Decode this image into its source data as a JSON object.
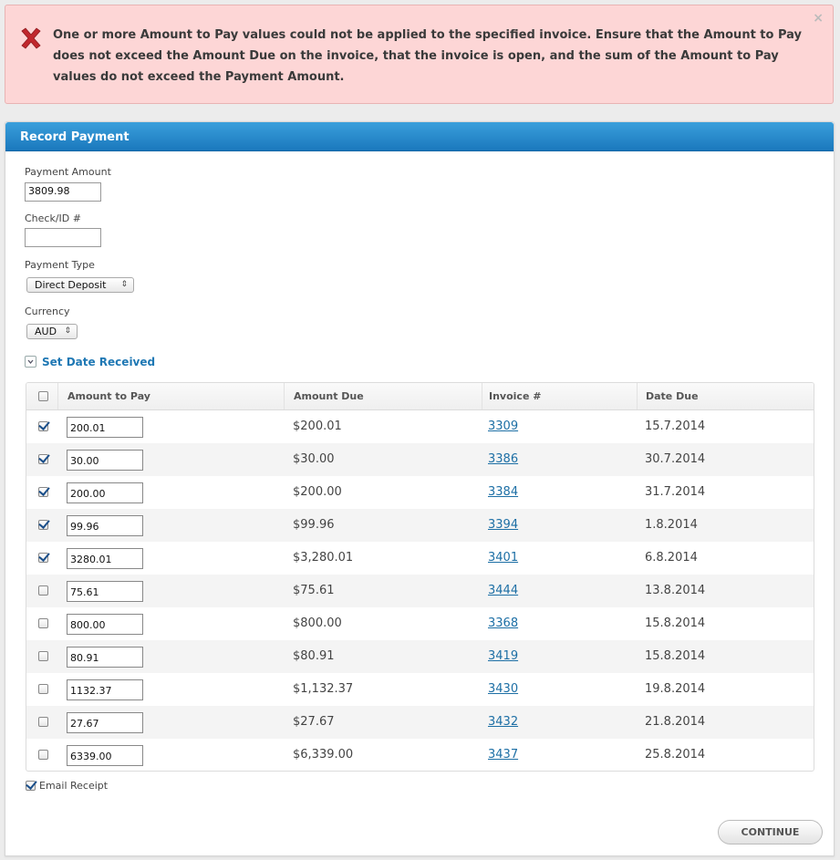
{
  "error": {
    "message": "One or more Amount to Pay values could not be applied to the specified invoice. Ensure that the Amount to Pay does not exceed the Amount Due on the invoice, that the invoice is open, and the sum of the Amount to Pay values do not exceed the Payment Amount.",
    "close": "×"
  },
  "panel": {
    "title": "Record Payment"
  },
  "form": {
    "payment_amount_label": "Payment Amount",
    "payment_amount_value": "3809.98",
    "check_id_label": "Check/ID #",
    "check_id_value": "",
    "payment_type_label": "Payment Type",
    "payment_type_value": "Direct Deposit",
    "currency_label": "Currency",
    "currency_value": "AUD",
    "set_date_label": "Set Date Received"
  },
  "table": {
    "headers": [
      "Amount to Pay",
      "Amount Due",
      "Invoice #",
      "Date Due"
    ],
    "rows": [
      {
        "checked": true,
        "amount_to_pay": "200.01",
        "amount_due": "$200.01",
        "invoice": "3309",
        "date_due": "15.7.2014"
      },
      {
        "checked": true,
        "amount_to_pay": "30.00",
        "amount_due": "$30.00",
        "invoice": "3386",
        "date_due": "30.7.2014"
      },
      {
        "checked": true,
        "amount_to_pay": "200.00",
        "amount_due": "$200.00",
        "invoice": "3384",
        "date_due": "31.7.2014"
      },
      {
        "checked": true,
        "amount_to_pay": "99.96",
        "amount_due": "$99.96",
        "invoice": "3394",
        "date_due": "1.8.2014"
      },
      {
        "checked": true,
        "amount_to_pay": "3280.01",
        "amount_due": "$3,280.01",
        "invoice": "3401",
        "date_due": "6.8.2014"
      },
      {
        "checked": false,
        "amount_to_pay": "75.61",
        "amount_due": "$75.61",
        "invoice": "3444",
        "date_due": "13.8.2014"
      },
      {
        "checked": false,
        "amount_to_pay": "800.00",
        "amount_due": "$800.00",
        "invoice": "3368",
        "date_due": "15.8.2014"
      },
      {
        "checked": false,
        "amount_to_pay": "80.91",
        "amount_due": "$80.91",
        "invoice": "3419",
        "date_due": "15.8.2014"
      },
      {
        "checked": false,
        "amount_to_pay": "1132.37",
        "amount_due": "$1,132.37",
        "invoice": "3430",
        "date_due": "19.8.2014"
      },
      {
        "checked": false,
        "amount_to_pay": "27.67",
        "amount_due": "$27.67",
        "invoice": "3432",
        "date_due": "21.8.2014"
      },
      {
        "checked": false,
        "amount_to_pay": "6339.00",
        "amount_due": "$6,339.00",
        "invoice": "3437",
        "date_due": "25.8.2014"
      }
    ]
  },
  "footer": {
    "email_receipt_label": "Email Receipt",
    "email_receipt_checked": true,
    "continue_label": "CONTINUE"
  },
  "colors": {
    "header_blue": "#1a78bd",
    "error_bg": "#fdd6d6",
    "error_icon": "#c0272d",
    "link": "#1d6fa5"
  }
}
